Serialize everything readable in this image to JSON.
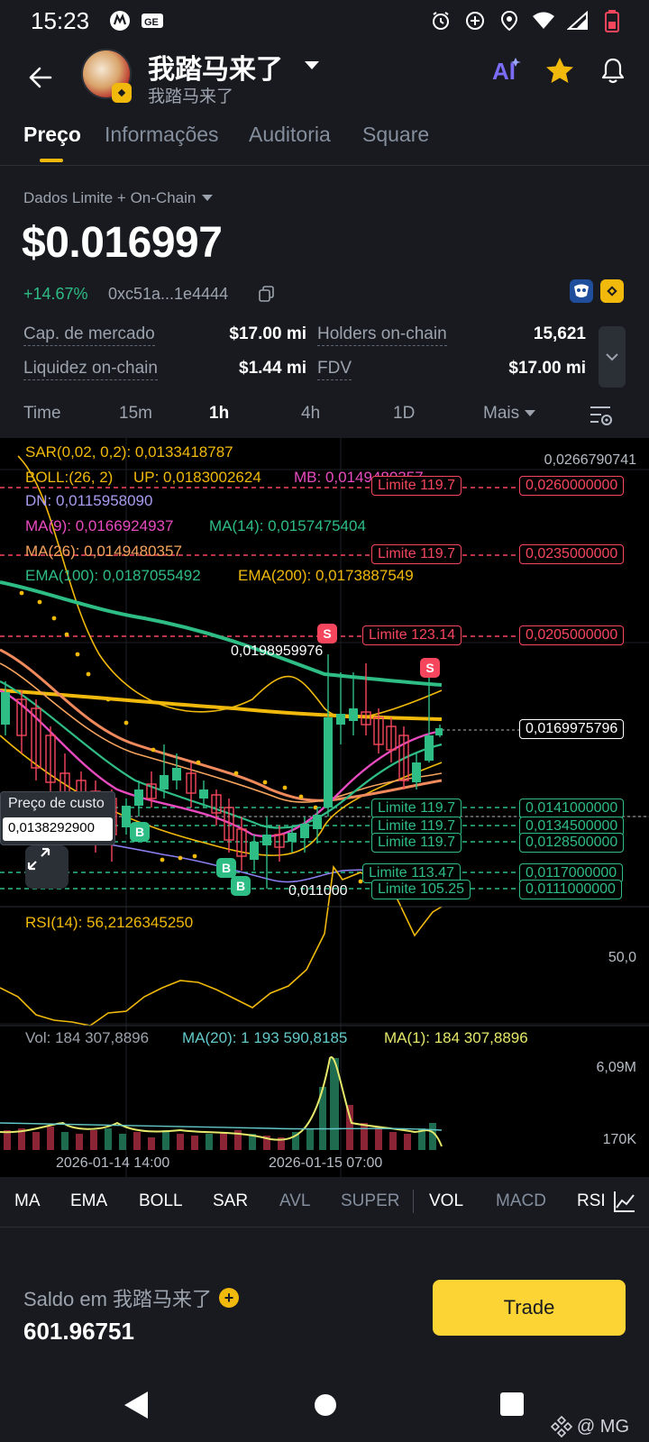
{
  "status": {
    "time": "15:23"
  },
  "header": {
    "title": "我踏马来了",
    "subtitle": "我踏马来了"
  },
  "tabs": [
    "Preço",
    "Informações",
    "Auditoria",
    "Square"
  ],
  "price_block": {
    "data_source": "Dados Limite + On-Chain",
    "price": "$0.016997",
    "change": "+14.67%",
    "contract": "0xc51a...1e4444"
  },
  "stats": {
    "market_cap_label": "Cap. de mercado",
    "market_cap": "$17.00 mi",
    "holders_label": "Holders on-chain",
    "holders": "15,621",
    "liquidity_label": "Liquidez on-chain",
    "liquidity": "$1.44 mi",
    "fdv_label": "FDV",
    "fdv": "$17.00 mi"
  },
  "timeframes": [
    "Time",
    "15m",
    "1h",
    "4h",
    "1D",
    "Mais"
  ],
  "chart": {
    "indicators": {
      "sar": "SAR(0,02, 0,2): 0,0133418787",
      "boll": "BOLL:(26, 2)",
      "boll_up": "UP: 0,0183002624",
      "boll_mb": "MB: 0,0149480357",
      "boll_dn": "DN: 0,0115958090",
      "ma9": "MA(9): 0,0166924937",
      "ma14": "MA(14): 0,0157475404",
      "ma26": "MA(26): 0,0149480357",
      "ema100": "EMA(100): 0,0187055492",
      "ema200": "EMA(200): 0,0173887549"
    },
    "axis_top": "0,0266790741",
    "current_price": "0,0169975796",
    "limit_orders": [
      {
        "label": "Limite 119.7",
        "price": "0,0260000000",
        "side": "sell"
      },
      {
        "label": "Limite 119.7",
        "price": "0,0235000000",
        "side": "sell"
      },
      {
        "label": "Limite 123.14",
        "price": "0,0205000000",
        "side": "sell"
      },
      {
        "label": "Limite 119.7",
        "price": "0,0141000000",
        "side": "buy"
      },
      {
        "label": "Limite 119.7",
        "price": "0,0134500000",
        "side": "buy"
      },
      {
        "label": "Limite 119.7",
        "price": "0,0128500000",
        "side": "buy"
      },
      {
        "label": "Limite 113.47",
        "price": "0,0117000000",
        "side": "buy"
      },
      {
        "label": "Limite 105.25",
        "price": "0,0111000000",
        "side": "buy"
      }
    ],
    "high_label": "0,0198959976",
    "low_label": "0,011000",
    "cost_label": "Preço de custo",
    "cost_value": "0,0138292900",
    "rsi": {
      "label": "RSI(14): 56,2126345250",
      "level": "50,0"
    },
    "vol": {
      "label": "Vol: 184 307,8896",
      "ma20": "MA(20): 1 193 590,8185",
      "ma1": "MA(1): 184 307,8896",
      "max": "6,09M",
      "min": "170K"
    },
    "dates": [
      "2026-01-14 14:00",
      "2026-01-15 07:00"
    ],
    "markers": {
      "sell": "S",
      "buy": "B"
    }
  },
  "indicator_tabs": [
    {
      "label": "MA",
      "on": true
    },
    {
      "label": "EMA",
      "on": true
    },
    {
      "label": "BOLL",
      "on": true
    },
    {
      "label": "SAR",
      "on": true
    },
    {
      "label": "AVL",
      "on": false
    },
    {
      "label": "SUPER",
      "on": false
    },
    {
      "label": "VOL",
      "on": true
    },
    {
      "label": "MACD",
      "on": false
    },
    {
      "label": "RSI",
      "on": true
    }
  ],
  "balance": {
    "label": "Saldo em 我踏马来了",
    "value": "601.96751"
  },
  "trade_button": "Trade",
  "watermark": "@ MG",
  "colors": {
    "accent": "#f0b90b",
    "up": "#2ebd85",
    "down": "#f6465d",
    "trade": "#fcd535"
  }
}
